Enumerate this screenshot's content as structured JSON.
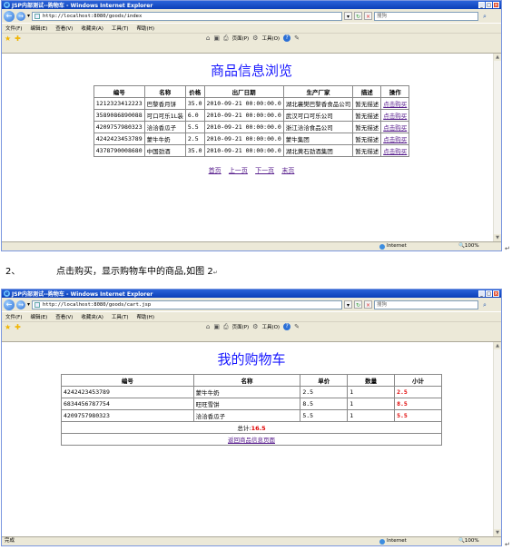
{
  "window1": {
    "title": "JSP内部测试--购物车 - Windows Internet Explorer",
    "address": "http://localhost:8080/goods/index",
    "search_placeholder": "搜狗",
    "menu": [
      "文件(F)",
      "编辑(E)",
      "查看(V)",
      "收藏夹(A)",
      "工具(T)",
      "帮助(H)"
    ],
    "toolbar": {
      "page": "页面(P)",
      "tools": "工具(O)"
    },
    "page_title": "商品信息浏览",
    "table": {
      "headers": [
        "编号",
        "名称",
        "价格",
        "出厂日期",
        "生产厂家",
        "描述",
        "操作"
      ],
      "rows": [
        [
          "1212323412223",
          "巴黎香月饼",
          "35.0",
          "2010-09-21  00:00:00.0",
          "湖北襄樊巴黎香食品公司",
          "暂无描述",
          "点击购买"
        ],
        [
          "3589086890088",
          "可口可乐1L装",
          "6.0",
          "2010-09-21  00:00:00.0",
          "武汉可口可乐公司",
          "暂无描述",
          "点击购买"
        ],
        [
          "4209757980323",
          "洽洽香瓜子",
          "5.5",
          "2010-09-21  00:00:00.0",
          "浙江洽洽食品公司",
          "暂无描述",
          "点击购买"
        ],
        [
          "4242423453789",
          "蒙牛牛奶",
          "2.5",
          "2010-09-21  00:00:00.0",
          "蒙牛集团",
          "暂无描述",
          "点击购买"
        ],
        [
          "4378790008680",
          "中国劲酒",
          "35.0",
          "2010-09-21  00:00:00.0",
          "湖北黄石劲酒集团",
          "暂无描述",
          "点击购买"
        ]
      ]
    },
    "pager": [
      "首页",
      "上一页",
      "下一页",
      "末页"
    ],
    "status": {
      "zone": "Internet",
      "zoom": "100%"
    }
  },
  "doc_text": {
    "num": "2、",
    "text": "点击购买，显示购物车中的商品,如图 2"
  },
  "window2": {
    "title": "JSP内部测试--购物车 - Windows Internet Explorer",
    "address": "http://localhost:8080/goods/cart.jsp",
    "search_placeholder": "搜狗",
    "menu": [
      "文件(F)",
      "编辑(E)",
      "查看(V)",
      "收藏夹(A)",
      "工具(T)",
      "帮助(H)"
    ],
    "toolbar": {
      "page": "页面(P)",
      "tools": "工具(O)"
    },
    "page_title": "我的购物车",
    "table": {
      "headers": [
        "编号",
        "名称",
        "单价",
        "数量",
        "小计"
      ],
      "rows": [
        [
          "4242423453789",
          "蒙牛牛奶",
          "2.5",
          "1",
          "2.5"
        ],
        [
          "6834456787754",
          "旺旺雪饼",
          "8.5",
          "1",
          "8.5"
        ],
        [
          "4209757980323",
          "洽洽香瓜子",
          "5.5",
          "1",
          "5.5"
        ]
      ],
      "total_label": "总计:",
      "total_value": "16.5",
      "back_link": "返回商品信息页面"
    },
    "status": {
      "left": "完成",
      "zone": "Internet",
      "zoom": "100%"
    }
  },
  "colors": {
    "title_blue": "#1a1aff",
    "link_purple": "#551a8b",
    "subtotal_red": "#e00000",
    "titlebar_blue": "#0b3fb8"
  }
}
